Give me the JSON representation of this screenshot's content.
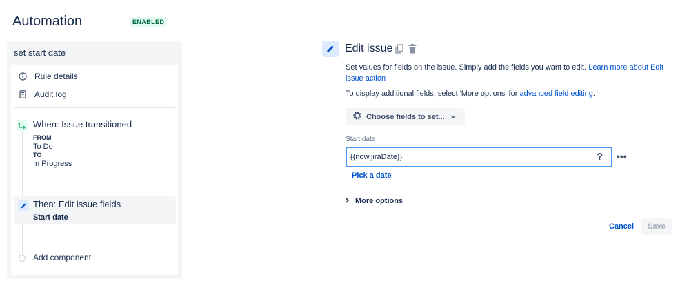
{
  "header": {
    "title": "Automation",
    "status": "ENABLED"
  },
  "rule": {
    "name": "set start date",
    "nav": [
      {
        "label": "Rule details",
        "icon": "info-icon"
      },
      {
        "label": "Audit log",
        "icon": "document-icon"
      }
    ],
    "trigger": {
      "title": "When: Issue transitioned",
      "from_label": "FROM",
      "from_value": "To Do",
      "to_label": "TO",
      "to_value": "In Progress",
      "icon": "transition-icon"
    },
    "action": {
      "title": "Then: Edit issue fields",
      "subtitle": "Start date",
      "icon": "pencil-icon"
    },
    "add_component": "Add component"
  },
  "editor": {
    "title": "Edit issue",
    "description": "Set values for fields on the issue. Simply add the fields you want to edit.",
    "learn_more": "Learn more about Edit issue action",
    "note_prefix": "To display additional fields, select 'More options' for",
    "note_link": "advanced field editing",
    "note_suffix": ".",
    "choose_fields": "Choose fields to set...",
    "field_label": "Start date",
    "field_value": "{{now.jiraDate}}",
    "help": "?",
    "more": "•••",
    "pick_date": "Pick a date",
    "more_options": "More options",
    "cancel": "Cancel",
    "save": "Save"
  },
  "colors": {
    "accent": "#0052cc",
    "enabled_text": "#006644",
    "enabled_bg": "#e3fcef",
    "input_border": "#4c9aff"
  }
}
